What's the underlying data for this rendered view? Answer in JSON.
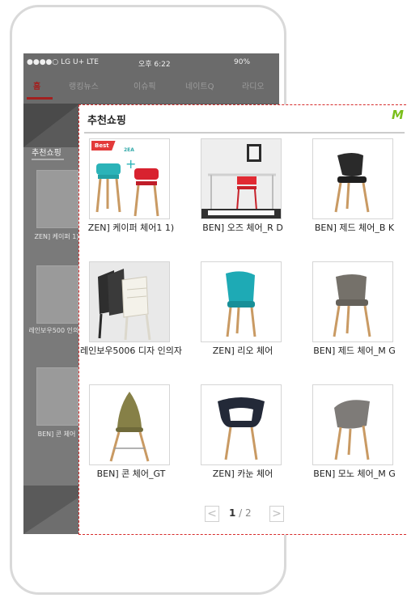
{
  "status_bar": {
    "carrier": "●●●●○ LG U+  LTE",
    "time": "오후 6:22",
    "battery": "90%"
  },
  "nav_tabs": [
    {
      "label": "홈",
      "active": true
    },
    {
      "label": "랭킹뉴스"
    },
    {
      "label": "이슈픽"
    },
    {
      "label": "네이트Q"
    },
    {
      "label": "라디오"
    }
  ],
  "background": {
    "section_label": "추천쇼핑",
    "caption_1": "ZEN] 케이퍼 1)",
    "caption_2": "레인보우500 인의자",
    "caption_3": "BEN] 콘 체어"
  },
  "popup": {
    "title": "추천쇼핑",
    "logo_fragment": "M",
    "products": [
      {
        "name": "ZEN] 케이퍼 체어1 1)",
        "badge": "Best",
        "badge_sub": "2EA",
        "icon": "chair-pair-icon"
      },
      {
        "name": "BEN] 오즈 체어_R D",
        "icon": "desk-chair-icon"
      },
      {
        "name": "BEN] 제드 체어_B K",
        "icon": "black-chair-icon"
      },
      {
        "name": "레인보우5006 디자 인의자",
        "icon": "stacked-chairs-icon"
      },
      {
        "name": "ZEN] 리오 체어",
        "icon": "teal-chair-icon"
      },
      {
        "name": "BEN] 제드 체어_M G",
        "icon": "gray-chair-icon"
      },
      {
        "name": "BEN] 콘 체어_GT",
        "icon": "olive-cone-chair-icon"
      },
      {
        "name": "ZEN] 카눈 체어",
        "icon": "navy-armchair-icon"
      },
      {
        "name": "BEN] 모노 체어_M G",
        "icon": "mono-gray-chair-icon"
      }
    ],
    "pager": {
      "prev": "<",
      "current": "1",
      "separator": " / ",
      "total": "2",
      "next": ">"
    }
  },
  "colors": {
    "accent_red": "#a3201f",
    "popup_border": "#d62b2b",
    "logo_green": "#7bbf1c",
    "best_badge": "#e33a3a"
  }
}
